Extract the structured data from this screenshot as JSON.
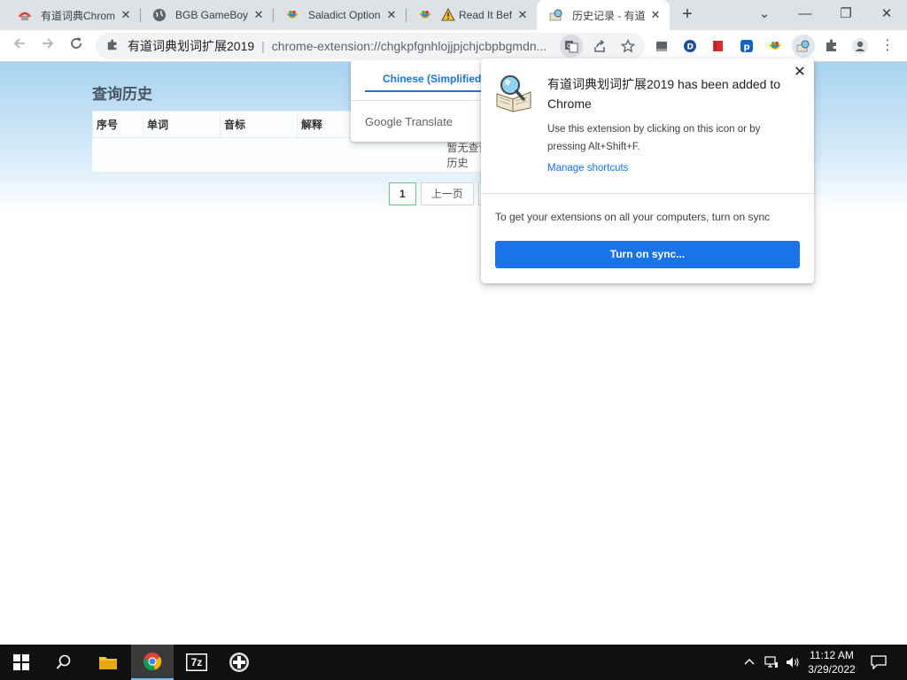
{
  "tabs": [
    {
      "title": "有道词典Chrome",
      "icon": "youdao-icon"
    },
    {
      "title": "BGB GameBoy E",
      "icon": "globe-icon"
    },
    {
      "title": "Saladict Options",
      "icon": "saladict-icon"
    },
    {
      "title": "Read It Before",
      "icon": "saladict-warning-icon"
    },
    {
      "title": "历史记录 - 有道",
      "icon": "youdao-dict-icon"
    }
  ],
  "window": {
    "minimize": "—",
    "restore": "❐",
    "close": "✕",
    "tab_search": "⌄"
  },
  "omnibox": {
    "site_name": "有道词典划词扩展2019",
    "url": "chrome-extension://chgkpfgnhlojjpjchjcbpbgmdn..."
  },
  "page": {
    "title": "查询历史",
    "table_headers": [
      "序号",
      "单词",
      "音标",
      "解释"
    ],
    "empty_message": "暂无查询历史",
    "pager": [
      "1",
      "上一页"
    ]
  },
  "translate_bubble": {
    "tab_label": "Chinese (Simplified)",
    "footer": "Google Translate"
  },
  "extension_popup": {
    "heading": "有道词典划词扩展2019 has been added to Chrome",
    "body": "Use this extension by clicking on this icon or by pressing Alt+Shift+F.",
    "manage_link": "Manage shortcuts",
    "sync_text": "To get your extensions on all your computers, turn on sync",
    "sync_button": "Turn on sync..."
  },
  "taskbar": {
    "time": "11:12 AM",
    "date": "3/29/2022",
    "sevenzip": "7z"
  },
  "colors": {
    "accent": "#1a73e8",
    "tabstrip": "#dee1e6",
    "taskbar": "#101010"
  }
}
